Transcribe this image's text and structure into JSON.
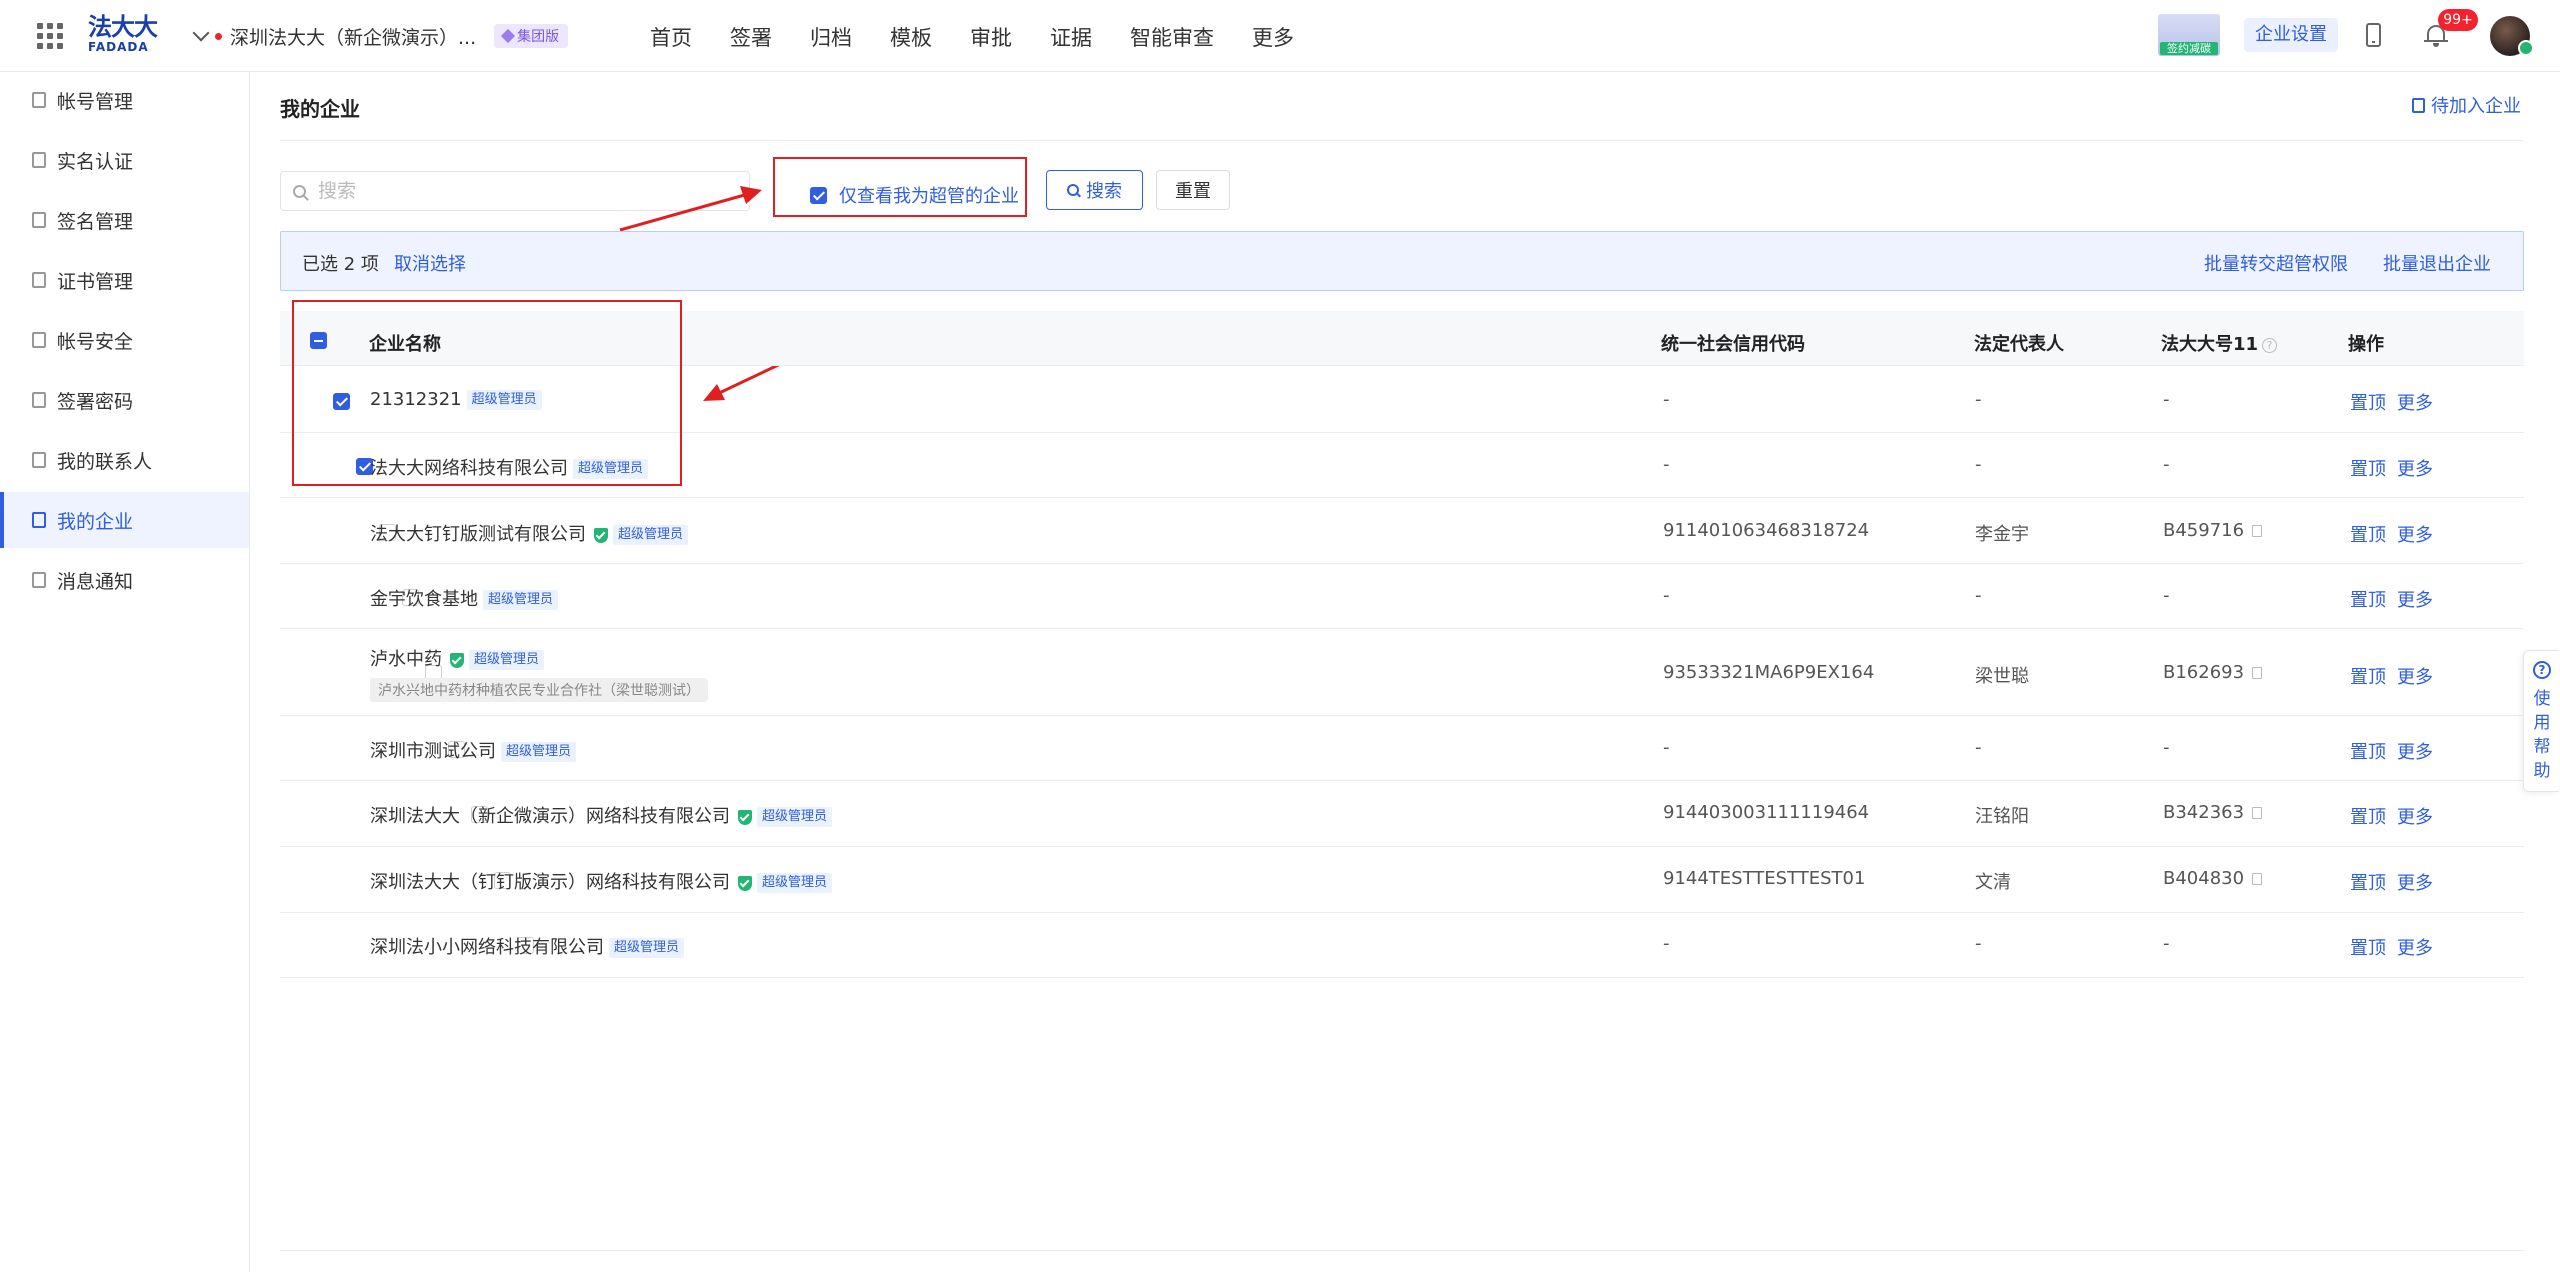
{
  "topbar": {
    "logo_cn": "法大大",
    "logo_en": "FADADA",
    "current_org": "深圳法大大（新企微演示）...",
    "org_badge": "集团版",
    "nav": [
      "首页",
      "签署",
      "归档",
      "模板",
      "审批",
      "证据",
      "智能审查",
      "更多"
    ],
    "promo_caption": "签约减碳",
    "enterprise_settings": "企业设置",
    "notification_count": "99+"
  },
  "sidebar": {
    "items": [
      {
        "label": "帐号管理",
        "icon": "account-icon"
      },
      {
        "label": "实名认证",
        "icon": "verify-icon"
      },
      {
        "label": "签名管理",
        "icon": "signature-icon"
      },
      {
        "label": "证书管理",
        "icon": "certificate-icon"
      },
      {
        "label": "帐号安全",
        "icon": "shield-icon"
      },
      {
        "label": "签署密码",
        "icon": "lock-icon"
      },
      {
        "label": "我的联系人",
        "icon": "contacts-icon"
      },
      {
        "label": "我的企业",
        "icon": "enterprise-icon",
        "active": true
      },
      {
        "label": "消息通知",
        "icon": "message-icon"
      }
    ]
  },
  "page": {
    "title": "我的企业",
    "pending_link": "待加入企业"
  },
  "filters": {
    "search_placeholder": "搜索",
    "only_super_admin_label": "仅查看我为超管的企业",
    "only_super_admin_checked": true,
    "search_button": "搜索",
    "reset_button": "重置"
  },
  "selection": {
    "count_text": "已选 2 项",
    "cancel": "取消选择",
    "batch_transfer": "批量转交超管权限",
    "batch_exit": "批量退出企业"
  },
  "table": {
    "columns": [
      "企业名称",
      "统一社会信用代码",
      "法定代表人",
      "法大大号11",
      "操作"
    ],
    "admin_tag": "超级管理员",
    "op_top": "置顶",
    "op_more": "更多",
    "rows": [
      {
        "name": "21312321",
        "verified": false,
        "sub": "",
        "credit_code": "-",
        "legal_rep": "-",
        "fdd_no": "-",
        "checked": true
      },
      {
        "name": "法大大网络科技有限公司",
        "verified": false,
        "sub": "",
        "credit_code": "-",
        "legal_rep": "-",
        "fdd_no": "-",
        "checked": true
      },
      {
        "name": "法大大钉钉版测试有限公司",
        "verified": true,
        "sub": "",
        "credit_code": "911401063468318724",
        "legal_rep": "李金宇",
        "fdd_no": "B459716",
        "checked": false
      },
      {
        "name": "金宇饮食基地",
        "verified": false,
        "sub": "",
        "credit_code": "-",
        "legal_rep": "-",
        "fdd_no": "-",
        "checked": false
      },
      {
        "name": "泸水中药",
        "verified": true,
        "sub": "泸水兴地中药材种植农民专业合作社（梁世聪测试）",
        "credit_code": "93533321MA6P9EX164",
        "legal_rep": "梁世聪",
        "fdd_no": "B162693",
        "checked": false
      },
      {
        "name": "深圳市测试公司",
        "verified": false,
        "sub": "",
        "credit_code": "-",
        "legal_rep": "-",
        "fdd_no": "-",
        "checked": false
      },
      {
        "name": "深圳法大大（新企微演示）网络科技有限公司",
        "verified": true,
        "sub": "",
        "credit_code": "914403003111119464",
        "legal_rep": "汪铭阳",
        "fdd_no": "B342363",
        "checked": false
      },
      {
        "name": "深圳法大大（钉钉版演示）网络科技有限公司",
        "verified": true,
        "sub": "",
        "credit_code": "9144TESTTESTTEST01",
        "legal_rep": "文清",
        "fdd_no": "B404830",
        "checked": false
      },
      {
        "name": "深圳法小小网络科技有限公司",
        "verified": false,
        "sub": "",
        "credit_code": "-",
        "legal_rep": "-",
        "fdd_no": "-",
        "checked": false
      }
    ]
  },
  "help": {
    "label": "使用帮助"
  },
  "colors": {
    "accent": "#2f5fe0",
    "annotation_red": "#e02020",
    "verified_green": "#22b573",
    "badge_red": "#f5222d"
  }
}
